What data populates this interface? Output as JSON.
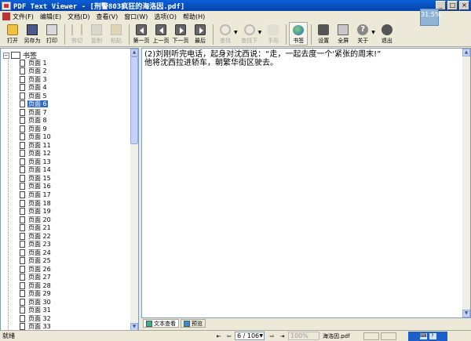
{
  "window": {
    "title": "PDF Text Viewer - [刑警803疯狂的海洛因.pdf]",
    "zoom_badge": "31.5%",
    "controls": {
      "minimize": "_",
      "maximize": "□",
      "close": "×"
    }
  },
  "menu": [
    "文件(F)",
    "编辑(E)",
    "文档(D)",
    "查看(V)",
    "窗口(W)",
    "选项(O)",
    "帮助(H)"
  ],
  "toolbar": {
    "open": "打开",
    "save_as": "另存为",
    "print": "打印",
    "cut": "剪切",
    "copy": "复制",
    "paste": "粘贴",
    "first_page": "第一页",
    "prev_page": "上一页",
    "next_page": "下一页",
    "last_page": "最后",
    "find": "查找",
    "find_next": "查找下",
    "hand": "手形",
    "bookmark": "书签",
    "settings": "设置",
    "fullscreen": "全屏",
    "about": "关于",
    "exit": "退出"
  },
  "tree": {
    "root_label": "书签",
    "selected_index": 5,
    "items": [
      "页面 1",
      "页面 2",
      "页面 3",
      "页面 4",
      "页面 5",
      "页面 6",
      "页面 7",
      "页面 8",
      "页面 9",
      "页面 10",
      "页面 11",
      "页面 12",
      "页面 13",
      "页面 14",
      "页面 15",
      "页面 16",
      "页面 17",
      "页面 18",
      "页面 19",
      "页面 20",
      "页面 21",
      "页面 22",
      "页面 23",
      "页面 24",
      "页面 25",
      "页面 26",
      "页面 27",
      "页面 28",
      "页面 29",
      "页面 30",
      "页面 31",
      "页面 32",
      "页面 33"
    ]
  },
  "content": {
    "lines": [
      "(2)刘刚听完电话，起身对沈西说：“走，一起去度一个'紧张的周末!”",
      "他将沈西拉进轿车，朝繁华街区驶去。"
    ]
  },
  "tabs": {
    "text_view": "文本查看",
    "preview": "预览"
  },
  "status": {
    "text": "就绪",
    "page": "6 / 106",
    "zoom": "100%",
    "file": "海洛因.pdf"
  }
}
